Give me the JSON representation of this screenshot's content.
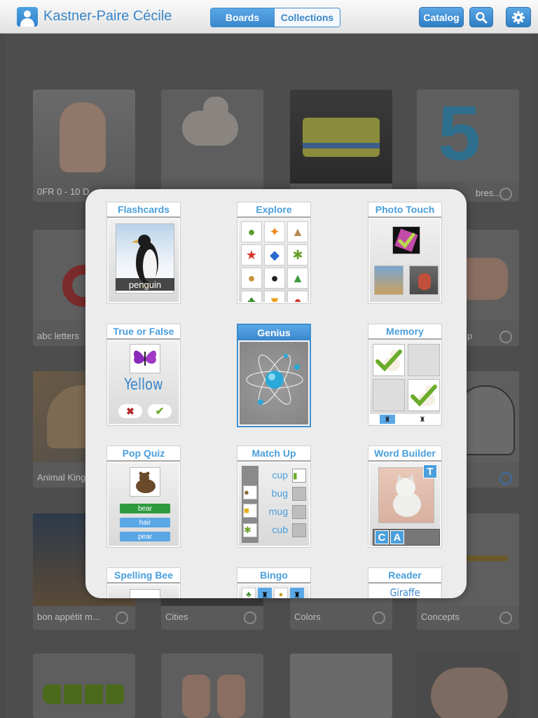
{
  "topbar": {
    "user_name": "Kastner-Paire Cécile",
    "tab_boards": "Boards",
    "tab_collections": "Collections",
    "catalog": "Catalog"
  },
  "tiles": [
    {
      "caption": "0FR 0 - 10 D",
      "icon": "hand-image"
    },
    {
      "caption": "",
      "icon": "lamb-image"
    },
    {
      "caption": "",
      "icon": "ambulance-image"
    },
    {
      "caption": "bres...",
      "icon": "number-five-image"
    },
    {
      "caption": "abc letters",
      "icon": "letter-image"
    },
    {
      "caption": "p",
      "icon": "hands-image"
    },
    {
      "caption": "Animal King",
      "icon": "antelope-image"
    },
    {
      "caption": "",
      "icon": "cat-drawing-image"
    },
    {
      "caption": "bon appétit m...",
      "icon": "book-image"
    },
    {
      "caption": "Cities",
      "icon": "city-image"
    },
    {
      "caption": "Colors",
      "icon": "colors-image"
    },
    {
      "caption": "Concepts",
      "icon": "table-image"
    },
    {
      "caption": "",
      "icon": "apples-image"
    },
    {
      "caption": "",
      "icon": "fingers-image"
    },
    {
      "caption": "",
      "icon": "dots-image"
    },
    {
      "caption": "",
      "icon": "baby-image"
    }
  ],
  "activities": {
    "flashcards": {
      "title": "Flashcards",
      "word": "penguin"
    },
    "explore": {
      "title": "Explore"
    },
    "photo_touch": {
      "title": "Photo Touch"
    },
    "true_false": {
      "title": "True or False",
      "word": "Yellow"
    },
    "genius": {
      "title": "Genius"
    },
    "memory": {
      "title": "Memory"
    },
    "pop_quiz": {
      "title": "Pop Quiz",
      "options": [
        "bear",
        "hair",
        "pear"
      ]
    },
    "match_up": {
      "title": "Match Up",
      "words": [
        "cup",
        "bug",
        "mug",
        "cub"
      ]
    },
    "word_builder": {
      "title": "Word Builder",
      "tile_letter": "T",
      "letters": [
        "C",
        "A"
      ]
    },
    "spelling_bee": {
      "title": "Spelling Bee"
    },
    "bingo": {
      "title": "Bingo"
    },
    "reader": {
      "title": "Reader",
      "word": "Giraffe"
    }
  },
  "colors": {
    "accent": "#3a86c8",
    "correct": "#2e9a3e",
    "option": "#5aa7e6"
  }
}
